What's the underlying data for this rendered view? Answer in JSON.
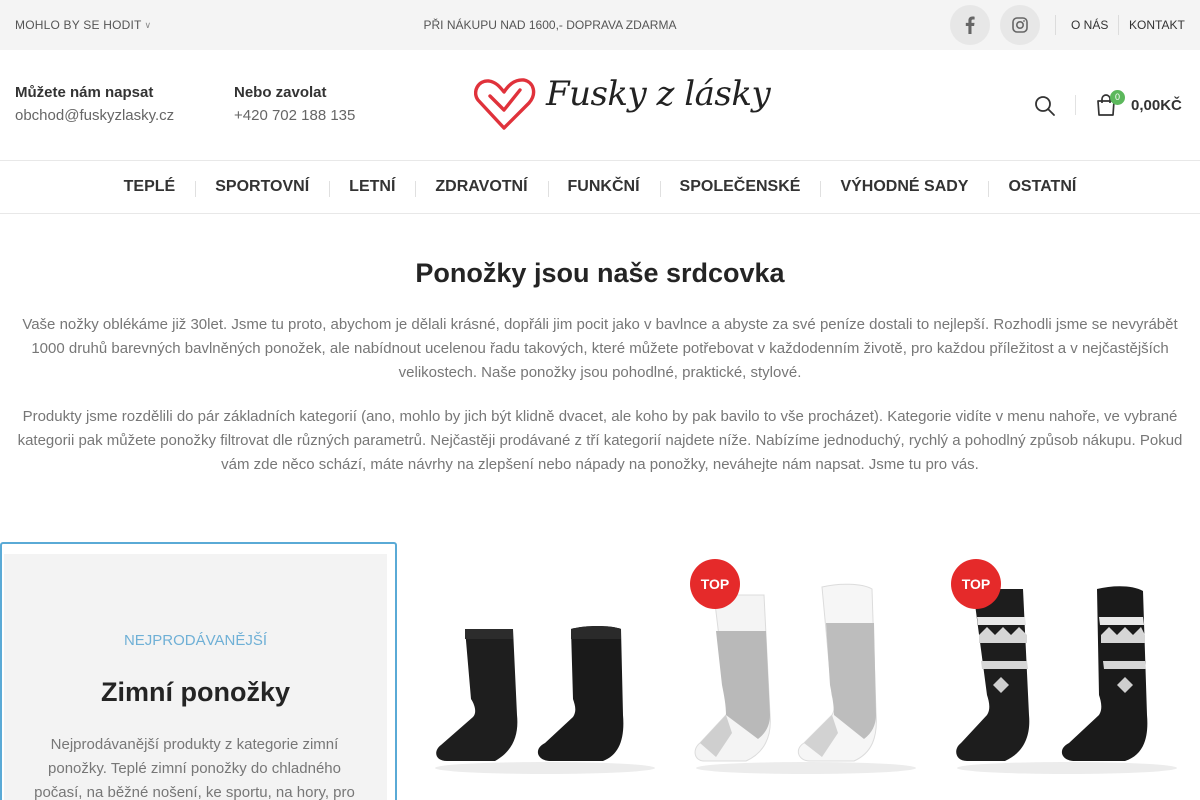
{
  "topbar": {
    "promo_left": "MOHLO BY SE HODIT",
    "shipping": "PŘI NÁKUPU NAD 1600,- DOPRAVA ZDARMA",
    "social": [
      "facebook-icon",
      "instagram-icon"
    ],
    "links": [
      "O NÁS",
      "KONTAKT"
    ]
  },
  "header": {
    "write_label": "Můžete nám napsat",
    "email": "obchod@fuskyzlasky.cz",
    "call_label": "Nebo zavolat",
    "phone": "+420 702 188 135",
    "logo_text": "Fusky z lásky",
    "cart_count": "0",
    "cart_total": "0,00KČ"
  },
  "nav": {
    "items": [
      "TEPLÉ",
      "SPORTOVNÍ",
      "LETNÍ",
      "ZDRAVOTNÍ",
      "FUNKČNÍ",
      "SPOLEČENSKÉ",
      "VÝHODNÉ SADY",
      "OSTATNÍ"
    ]
  },
  "intro": {
    "title": "Ponožky jsou naše srdcovka",
    "p1": "Vaše nožky oblékáme již 30let. Jsme tu proto, abychom je dělali krásné, dopřáli jim pocit jako v bavlnce a abyste za své peníze dostali to nejlepší. Rozhodli jsme se nevyrábět 1000 druhů barevných bavlněných ponožek, ale nabídnout ucelenou řadu takových, které můžete potřebovat v každodenním životě, pro každou příležitost a v nejčastějších velikostech. Naše ponožky jsou pohodlné, praktické, stylové.",
    "p2": "Produkty jsme rozdělili do pár základních kategorií (ano, mohlo by jich být klidně dvacet, ale koho by pak bavilo to vše procházet). Kategorie vidíte v menu nahoře, ve vybrané kategorii pak můžete ponožky filtrovat dle různých parametrů. Nejčastěji prodávané z tří kategorií najdete níže. Nabízíme jednoduchý, rychlý a pohodlný způsob nákupu. Pokud vám zde něco schází, máte návrhy na zlepšení nebo nápady na ponožky, neváhejte nám napsat. Jsme tu pro vás."
  },
  "feature": {
    "kicker": "NEJPRODÁVANĚJŠÍ",
    "title": "Zimní ponožky",
    "desc": "Nejprodávanější produkty z kategorie zimní ponožky. Teplé zimní ponožky do chladného počasí, na běžné nošení, ke sportu, na hory, pro"
  },
  "products": [
    {
      "name": "black-ankle-socks",
      "badge": ""
    },
    {
      "name": "white-grey-sport-socks",
      "badge": "TOP"
    },
    {
      "name": "black-nordic-pattern-socks",
      "badge": "TOP"
    }
  ],
  "colors": {
    "accent_blue": "#5aaad6",
    "badge_red": "#e52a2a",
    "logo_red": "#e0323b",
    "cart_green": "#5cb85c"
  }
}
